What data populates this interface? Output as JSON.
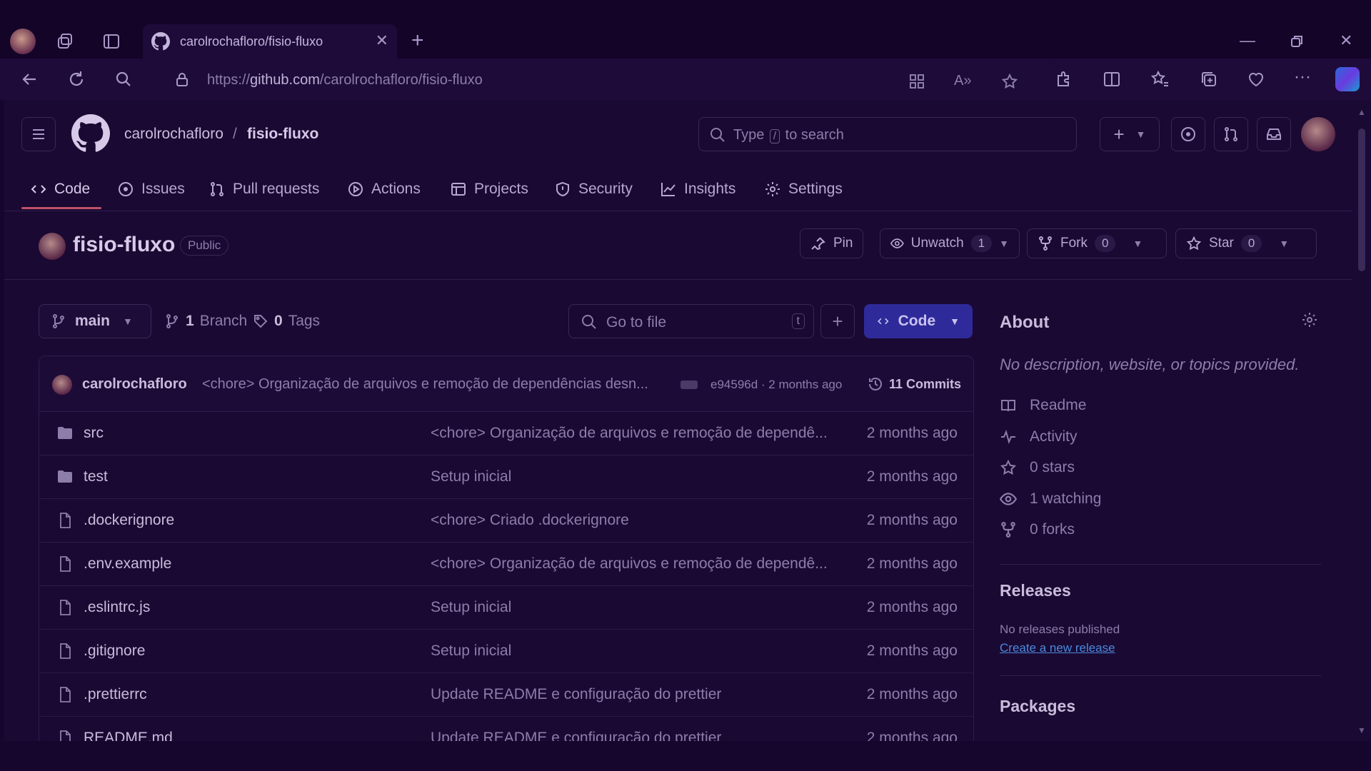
{
  "browser": {
    "tab_title": "carolrochafloro/fisio-fluxo",
    "url_prefix": "https://",
    "url_domain": "github.com",
    "url_path": "/carolrochafloro/fisio-fluxo"
  },
  "header": {
    "owner": "carolrochafloro",
    "separator": "/",
    "repo": "fisio-fluxo",
    "search_prefix": "Type",
    "search_key": "/",
    "search_suffix": "to search"
  },
  "repo_nav": [
    {
      "label": "Code",
      "icon": "code-icon"
    },
    {
      "label": "Issues",
      "icon": "issue-icon"
    },
    {
      "label": "Pull requests",
      "icon": "pull-request-icon"
    },
    {
      "label": "Actions",
      "icon": "play-icon"
    },
    {
      "label": "Projects",
      "icon": "table-icon"
    },
    {
      "label": "Security",
      "icon": "shield-icon"
    },
    {
      "label": "Insights",
      "icon": "graph-icon"
    },
    {
      "label": "Settings",
      "icon": "gear-icon"
    }
  ],
  "repo": {
    "name": "fisio-fluxo",
    "visibility": "Public",
    "pin_label": "Pin",
    "watch_label": "Unwatch",
    "watch_count": "1",
    "fork_label": "Fork",
    "fork_count": "0",
    "star_label": "Star",
    "star_count": "0"
  },
  "branchbar": {
    "branch": "main",
    "branches_count": "1",
    "branches_label": "Branch",
    "tags_count": "0",
    "tags_label": "Tags",
    "gofile_placeholder": "Go to file",
    "gofile_key": "t",
    "code_label": "Code"
  },
  "latest_commit": {
    "author": "carolrochafloro",
    "message": "<chore> Organização de arquivos e remoção de dependências desn...",
    "sha_time": "e94596d · 2 months ago",
    "commits_label": "11 Commits"
  },
  "files": [
    {
      "type": "folder",
      "name": "src",
      "message": "<chore> Organização de arquivos e remoção de dependê...",
      "date": "2 months ago"
    },
    {
      "type": "folder",
      "name": "test",
      "message": "Setup inicial",
      "date": "2 months ago"
    },
    {
      "type": "file",
      "name": ".dockerignore",
      "message": "<chore> Criado .dockerignore",
      "date": "2 months ago"
    },
    {
      "type": "file",
      "name": ".env.example",
      "message": "<chore> Organização de arquivos e remoção de dependê...",
      "date": "2 months ago"
    },
    {
      "type": "file",
      "name": ".eslintrc.js",
      "message": "Setup inicial",
      "date": "2 months ago"
    },
    {
      "type": "file",
      "name": ".gitignore",
      "message": "Setup inicial",
      "date": "2 months ago"
    },
    {
      "type": "file",
      "name": ".prettierrc",
      "message": "Update README e configuração do prettier",
      "date": "2 months ago"
    },
    {
      "type": "file",
      "name": "README.md",
      "message": "Update README e configuração do prettier",
      "date": "2 months ago"
    }
  ],
  "about": {
    "title": "About",
    "description": "No description, website, or topics provided.",
    "items": [
      {
        "icon": "book-icon",
        "label": "Readme"
      },
      {
        "icon": "pulse-icon",
        "label": "Activity"
      },
      {
        "icon": "star-icon",
        "label": "0 stars"
      },
      {
        "icon": "eye-icon",
        "label": "1 watching"
      },
      {
        "icon": "fork-icon",
        "label": "0 forks"
      }
    ]
  },
  "releases": {
    "title": "Releases",
    "empty": "No releases published",
    "create_link": "Create a new release"
  },
  "packages": {
    "title": "Packages"
  },
  "colors": {
    "accent": "#2f2a9a",
    "active_tab_underline": "#c0506a",
    "link": "#4a8ae0"
  }
}
